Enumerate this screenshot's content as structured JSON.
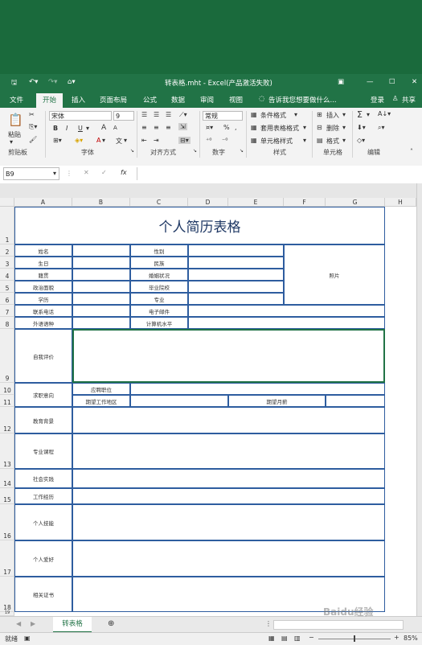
{
  "window": {
    "title": "转表格.mht - Excel(产品激活失败)"
  },
  "tabs": [
    "文件",
    "开始",
    "插入",
    "页面布局",
    "公式",
    "数据",
    "审阅",
    "视图"
  ],
  "tell_me": "告诉我您想要做什么...",
  "login": "登录",
  "share": "共享",
  "ribbon": {
    "paste": "粘贴",
    "clipboard": "剪贴板",
    "font_name": "宋体",
    "font_size": "9",
    "font_group": "字体",
    "align_group": "对齐方式",
    "number_format": "常规",
    "number_group": "数字",
    "cond_format": "条件格式",
    "table_format": "套用表格格式",
    "cell_style": "单元格样式",
    "style_group": "样式",
    "insert": "插入",
    "delete": "删除",
    "format": "格式",
    "cells_group": "单元格",
    "edit_group": "编辑",
    "bold": "B",
    "italic": "I",
    "underline": "U",
    "grow": "A",
    "shrink": "A",
    "wen": "文",
    "percent": "%",
    "comma": ","
  },
  "formula": {
    "name_box": "B9",
    "fx": "fx"
  },
  "columns": [
    "A",
    "B",
    "C",
    "D",
    "E",
    "F",
    "G",
    "H"
  ],
  "rows": [
    "1",
    "2",
    "3",
    "4",
    "5",
    "6",
    "7",
    "8",
    "9",
    "10",
    "11",
    "12",
    "13",
    "14",
    "15",
    "16",
    "17",
    "18",
    "19"
  ],
  "resume": {
    "title": "个人简历表格",
    "name": "姓名",
    "gender": "性别",
    "birth": "生日",
    "ethnicity": "民族",
    "origin": "籍贯",
    "marital": "婚姻状况",
    "political": "政治面貌",
    "graduate": "毕业院校",
    "education": "学历",
    "major": "专业",
    "photo": "照片",
    "phone": "联系电话",
    "email": "电子邮件",
    "language": "外语语种",
    "computer": "计算机水平",
    "self_eval": "自我评价",
    "job_intent": "求职意向",
    "position": "应聘职位",
    "work_area": "期望工作地区",
    "salary": "期望月薪",
    "edu_bg": "教育背景",
    "courses": "专业课程",
    "social": "社会实践",
    "work_exp": "工作经历",
    "skills": "个人技能",
    "hobby": "个人爱好",
    "certs": "相关证书"
  },
  "sheet_tab": "转表格",
  "status": {
    "ready": "就绪",
    "zoom": "85%"
  },
  "watermark": "Baidu经验"
}
